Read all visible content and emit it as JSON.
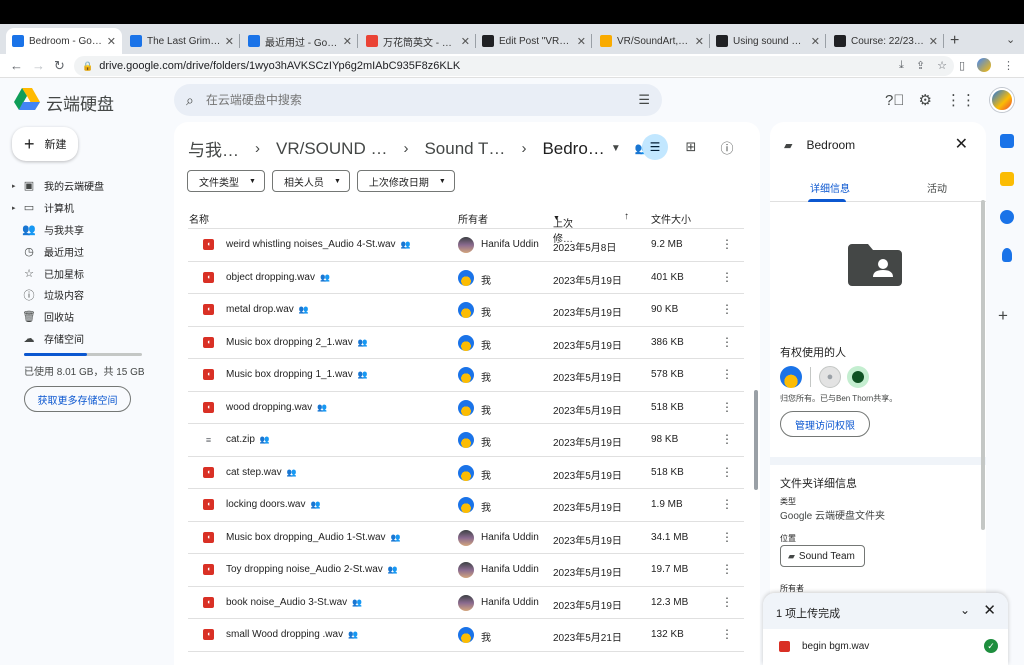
{
  "browser": {
    "tabs": [
      {
        "title": "Bedroom - Google",
        "favicon": "drive-icon",
        "color": "#1a73e8"
      },
      {
        "title": "The Last Grimm Tal",
        "favicon": "drive-icon",
        "color": "#1a73e8"
      },
      {
        "title": "最近用过 - Google",
        "favicon": "drive-icon",
        "color": "#1a73e8"
      },
      {
        "title": "万花筒英文 - Googl",
        "favicon": "google-icon",
        "color": "#ea4335"
      },
      {
        "title": "Edit Post \"VR12—Wi",
        "favicon": "site-icon",
        "color": "#202124"
      },
      {
        "title": "VR/SoundArt, Onli",
        "favicon": "site-icon",
        "color": "#f9ab00"
      },
      {
        "title": "Using sound desig",
        "favicon": "site-icon",
        "color": "#202124"
      },
      {
        "title": "Course: 22/23 Coll",
        "favicon": "site-icon",
        "color": "#202124"
      }
    ],
    "url": "drive.google.com/drive/folders/1wyo3hAVKSCzIYp6g2mIAbC935F8z6KLK"
  },
  "header": {
    "app_title": "云端硬盘",
    "search_placeholder": "在云端硬盘中搜索"
  },
  "sidebar": {
    "new_label": "新建",
    "items": [
      {
        "label": "我的云端硬盘",
        "icon": "my-drive-icon",
        "glyph": "▣",
        "caret": "▸"
      },
      {
        "label": "计算机",
        "icon": "computer-icon",
        "glyph": "▭",
        "caret": "▸"
      },
      {
        "label": "与我共享",
        "icon": "shared-icon",
        "glyph": "👥",
        "caret": ""
      },
      {
        "label": "最近用过",
        "icon": "recent-icon",
        "glyph": "◷",
        "caret": ""
      },
      {
        "label": "已加星标",
        "icon": "star-icon",
        "glyph": "☆",
        "caret": ""
      },
      {
        "label": "垃圾内容",
        "icon": "spam-icon",
        "glyph": "ⓘ",
        "caret": ""
      },
      {
        "label": "回收站",
        "icon": "trash-icon",
        "glyph": "🗑",
        "caret": ""
      },
      {
        "label": "存储空间",
        "icon": "cloud-icon",
        "glyph": "☁",
        "caret": ""
      }
    ],
    "storage_fraction": 0.534,
    "storage_text": "已使用 8.01 GB，共 15 GB",
    "get_more_label": "获取更多存储空间"
  },
  "main": {
    "breadcrumb": [
      "与我…",
      "VR/SOUND …",
      "Sound T…",
      "Bedro…"
    ],
    "filters": [
      "文件类型",
      "相关人员",
      "上次修改日期"
    ],
    "columns": {
      "name": "名称",
      "owner": "所有者",
      "modified": "上次修…",
      "size": "文件大小"
    },
    "files": [
      {
        "name": "weird whistling noises_Audio 4-St.wav",
        "owner": "Hanifa Uddin",
        "owner_type": "hu",
        "modified": "2023年5月8日",
        "size": "9.2 MB",
        "type": "audio"
      },
      {
        "name": "object dropping.wav",
        "owner": "我",
        "owner_type": "me",
        "modified": "2023年5月19日",
        "size": "401 KB",
        "type": "audio"
      },
      {
        "name": "metal drop.wav",
        "owner": "我",
        "owner_type": "me",
        "modified": "2023年5月19日",
        "size": "90 KB",
        "type": "audio"
      },
      {
        "name": "Music box dropping 2_1.wav",
        "owner": "我",
        "owner_type": "me",
        "modified": "2023年5月19日",
        "size": "386 KB",
        "type": "audio"
      },
      {
        "name": "Music box dropping 1_1.wav",
        "owner": "我",
        "owner_type": "me",
        "modified": "2023年5月19日",
        "size": "578 KB",
        "type": "audio"
      },
      {
        "name": "wood dropping.wav",
        "owner": "我",
        "owner_type": "me",
        "modified": "2023年5月19日",
        "size": "518 KB",
        "type": "audio"
      },
      {
        "name": "cat.zip",
        "owner": "我",
        "owner_type": "me",
        "modified": "2023年5月19日",
        "size": "98 KB",
        "type": "zip"
      },
      {
        "name": "cat step.wav",
        "owner": "我",
        "owner_type": "me",
        "modified": "2023年5月19日",
        "size": "518 KB",
        "type": "audio"
      },
      {
        "name": "locking doors.wav",
        "owner": "我",
        "owner_type": "me",
        "modified": "2023年5月19日",
        "size": "1.9 MB",
        "type": "audio"
      },
      {
        "name": "Music box dropping_Audio 1-St.wav",
        "owner": "Hanifa Uddin",
        "owner_type": "hu",
        "modified": "2023年5月19日",
        "size": "34.1 MB",
        "type": "audio"
      },
      {
        "name": "Toy dropping noise_Audio 2-St.wav",
        "owner": "Hanifa Uddin",
        "owner_type": "hu",
        "modified": "2023年5月19日",
        "size": "19.7 MB",
        "type": "audio"
      },
      {
        "name": "book noise_Audio 3-St.wav",
        "owner": "Hanifa Uddin",
        "owner_type": "hu",
        "modified": "2023年5月19日",
        "size": "12.3 MB",
        "type": "audio"
      },
      {
        "name": "small Wood dropping .wav",
        "owner": "我",
        "owner_type": "me",
        "modified": "2023年5月21日",
        "size": "132 KB",
        "type": "audio"
      }
    ]
  },
  "details": {
    "title": "Bedroom",
    "tabs": [
      "详细信息",
      "活动"
    ],
    "access_heading": "有权使用的人",
    "owner_info": "归您所有。已与Ben Thorn共享。",
    "manage_label": "管理访问权限",
    "folder_details_heading": "文件夹详细信息",
    "type_label": "类型",
    "type_value": "Google 云端硬盘文件夹",
    "location_label": "位置",
    "location_value": "Sound Team",
    "owner_label": "所有者"
  },
  "upload": {
    "title": "1 项上传完成",
    "file": "begin bgm.wav"
  }
}
